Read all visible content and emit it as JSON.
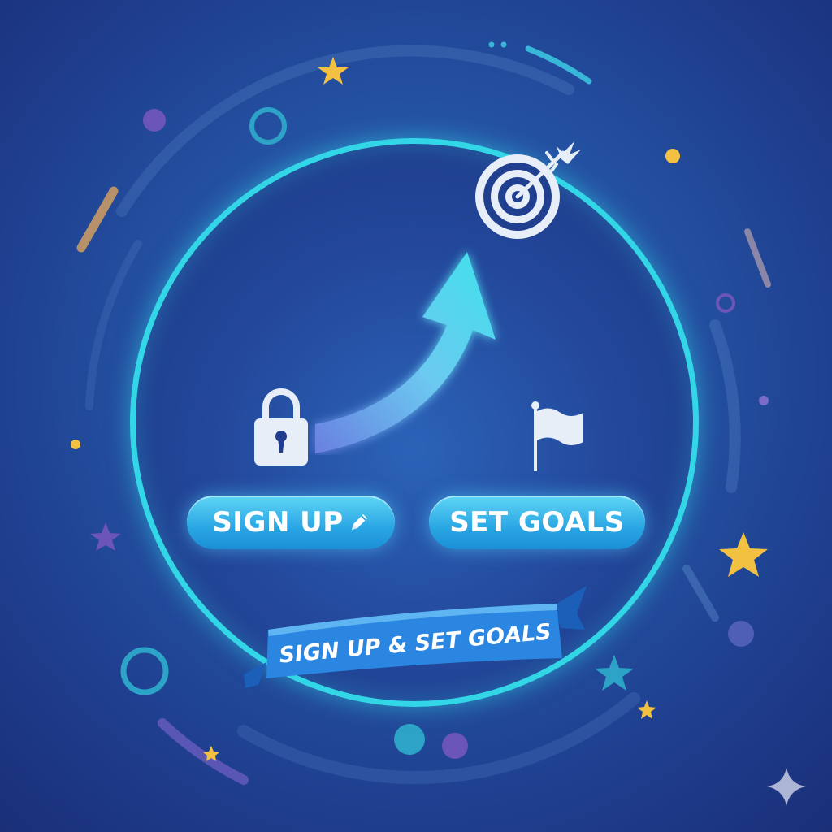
{
  "buttons": {
    "sign_up_label": "SIGN UP",
    "set_goals_label": "SET GOALS"
  },
  "banner": {
    "text": "SIGN UP & SET GOALS"
  },
  "icons": [
    "lock-icon",
    "pencil-icon",
    "flag-icon",
    "target-icon",
    "arrow-icon",
    "star-icon",
    "sparkle-icon"
  ],
  "colors": {
    "background": "#2657a8",
    "ring": "#32d6e6",
    "button": "#2aa6e4",
    "banner": "#2a86e0",
    "star": "#f2c141"
  }
}
